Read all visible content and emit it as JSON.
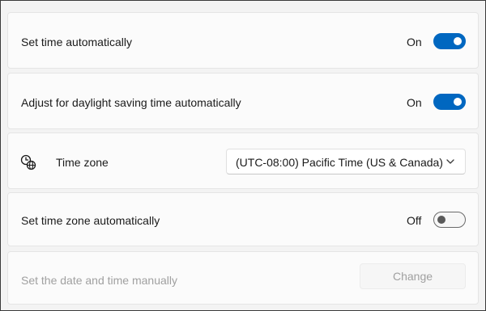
{
  "settings": {
    "set_time_auto": {
      "label": "Set time automatically",
      "state_label": "On",
      "enabled": true
    },
    "daylight_saving": {
      "label": "Adjust for daylight saving time automatically",
      "state_label": "On",
      "enabled": true
    },
    "time_zone": {
      "label": "Time zone",
      "icon": "time-zone-icon",
      "selected_value": "(UTC-08:00) Pacific Time (US & Canada)"
    },
    "set_time_zone_auto": {
      "label": "Set time zone automatically",
      "state_label": "Off",
      "enabled": false
    },
    "manual": {
      "label": "Set the date and time manually",
      "button_label": "Change",
      "disabled": true
    }
  },
  "colors": {
    "accent": "#0067c0",
    "background": "#f3f3f3",
    "card": "#fbfbfb",
    "disabled_text": "#a0a0a0"
  }
}
